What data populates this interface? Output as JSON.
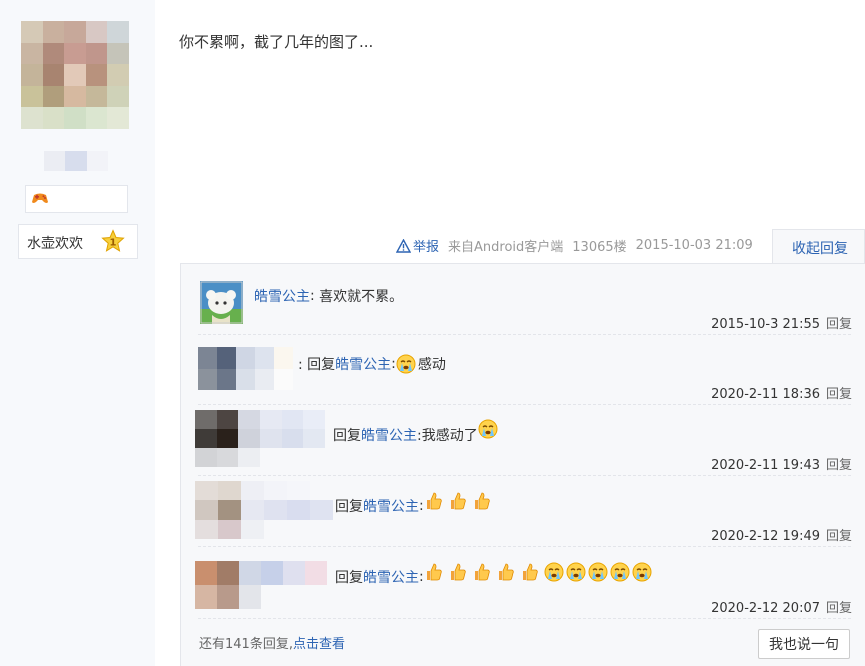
{
  "author": {
    "level_name": "水壶欢欢",
    "level_number": "1",
    "badge_icon": "game-controller-icon",
    "avatar_colors": [
      "#d5c9b6",
      "#c9b09e",
      "#c7a89a",
      "#d8c8c4",
      "#cfd6d9",
      "#c9b5a2",
      "#b08a7b",
      "#c89c92",
      "#c0968c",
      "#c5c4b9",
      "#c4b49a",
      "#a88470",
      "#e2c9b8",
      "#b8927d",
      "#d2ccb2",
      "#c9c29a",
      "#b09e7c",
      "#d6b9a0",
      "#c5b89a",
      "#cfd2b8",
      "#dde2cf",
      "#d9e0c8",
      "#d0dfc6",
      "#dbe6d0",
      "#e3e8d6"
    ],
    "name_colors": [
      "#ebedf3",
      "#d7dded",
      "#f2f3f8"
    ]
  },
  "post": {
    "text": "你不累啊，截了几年的图了...",
    "report": "举报",
    "source": "来自Android客户端",
    "floor": "13065楼",
    "time": "2015-10-03 21:09",
    "collapse": "收起回复"
  },
  "replies": [
    {
      "user": "皓雪公主",
      "prefix": "",
      "content": "喜欢就不累。",
      "time": "2015-10-3 21:55",
      "reply_label": "回复"
    },
    {
      "user": "",
      "prefix": ": 回复 ",
      "target": "皓雪公主",
      "content": " :",
      "tail": "感动",
      "emoji": "crying",
      "time": "2020-2-11 18:36",
      "reply_label": "回复"
    },
    {
      "user": "",
      "prefix": "回复 ",
      "target": "皓雪公主",
      "content": " :我感动了",
      "time": "2020-2-11 19:43",
      "reply_label": "回复"
    },
    {
      "user": "",
      "prefix": "回复 ",
      "target": "皓雪公主",
      "content": " :",
      "time": "2020-2-12 19:49",
      "reply_label": "回复"
    },
    {
      "user": "",
      "prefix": "回复 ",
      "target": "皓雪公主",
      "content": " :",
      "time": "2020-2-12 20:07",
      "reply_label": "回复"
    }
  ],
  "footer": {
    "more_prefix": "还有141条回复,",
    "more_link": "点击查看",
    "say_button": "我也说一句"
  },
  "colors": {
    "link": "#2d64b3",
    "panel": "#f7f8fa",
    "sidebar": "#f7f9fc"
  }
}
